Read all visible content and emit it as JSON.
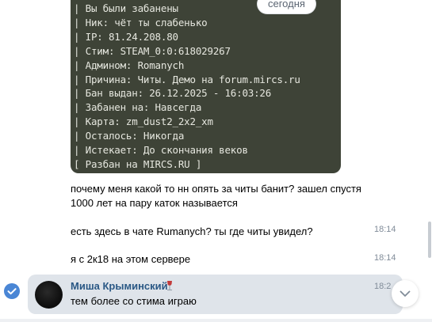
{
  "date_separator": "сегодня",
  "ban_screenshot": {
    "lines": [
      "| Вы были забанены",
      "| Ник: чёт ты слабенько",
      "| IP: 81.24.208.80",
      "| Стим: STEAM_0:0:618029267",
      "| Админом: Romanych",
      "| Причина: Читы. Демо на forum.mircs.ru",
      "| Бан выдан: 26.12.2025 - 16:03:26",
      "| Забанен на: Навсегда",
      "| Карта: zm_dust2_2x2_xm",
      "| Осталось: Никогда",
      "| Истекает: До скончания веков",
      "[ Разбан на MIRCS.RU ]"
    ]
  },
  "messages": [
    {
      "text_line1": "почему меня какой то нн опять за читы банит? зашел спустя",
      "text_line2": "1000 лет на пару каток называется",
      "time": ""
    },
    {
      "text": "есть здесь в чате Rumanych? ты где читы увидел?",
      "time": "18:14"
    },
    {
      "text": "я с 2к18 на этом сервере",
      "time": "18:14"
    }
  ],
  "selected_message": {
    "author": "Миша Крыминский",
    "text": "тем более со стима играю",
    "time": "18:2",
    "author_color": "#2a5885",
    "highlight_color": "#dfe4ea",
    "check_color": "#4a86d5"
  },
  "icons": {
    "check": "check-circle-icon",
    "author_badge": "wine-glass-icon",
    "scroll": "chevron-down-icon"
  }
}
